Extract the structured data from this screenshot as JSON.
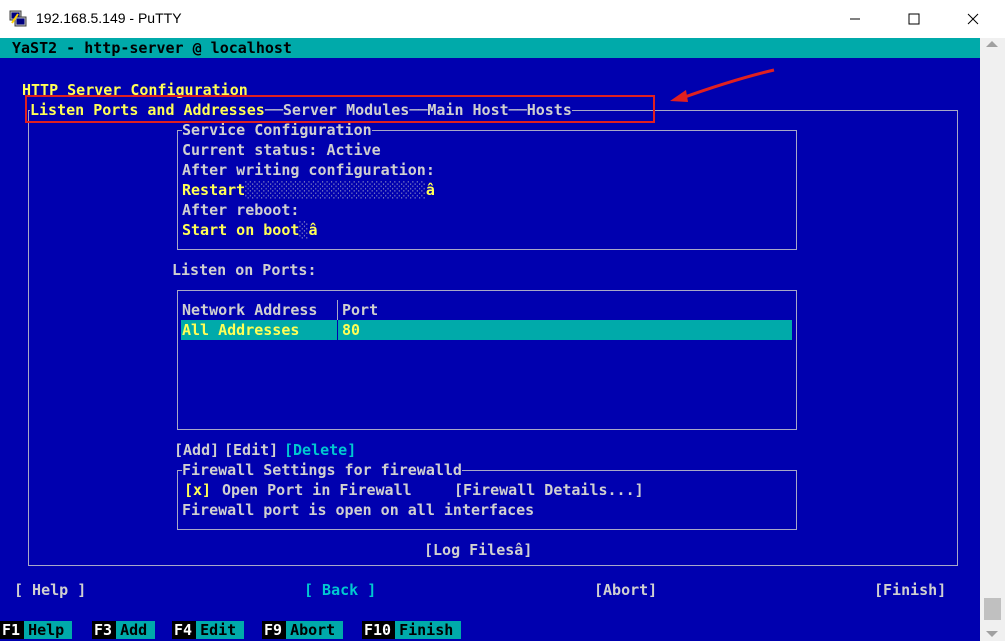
{
  "window": {
    "title": "192.168.5.149 - PuTTY"
  },
  "yast": {
    "header": "YaST2 - http-server @ localhost",
    "page_title": "HTTP Server Configuration",
    "tabs": [
      {
        "label": "Listen Ports and Addresses"
      },
      {
        "label": "Server Modules"
      },
      {
        "label": "Main Host"
      },
      {
        "label": "Hosts"
      }
    ],
    "service": {
      "frame_label": "Service Configuration",
      "current_status": "Current status: Active",
      "after_writing": "After writing configuration:",
      "after_writing_value": "Restart",
      "after_reboot": "After reboot:",
      "after_reboot_value": "Start on boot",
      "dropdown_glyph": "â"
    },
    "ports": {
      "label": "Listen on Ports:",
      "columns": [
        "Network Address",
        "Port"
      ],
      "rows": [
        {
          "address": "All Addresses",
          "port": "80"
        }
      ],
      "add_button": "[Add]",
      "edit_button": "[Edit]",
      "delete_button": "[Delete]"
    },
    "firewall": {
      "frame_label": "Firewall Settings for firewalld",
      "checkbox_state": "[x]",
      "checkbox_label": "Open Port in Firewall",
      "details_button": "[Firewall Details...]",
      "status_text": "Firewall port is open on all interfaces"
    },
    "log_files_button": "[Log Filesâ]",
    "bottom_buttons": {
      "help": "[ Help ]",
      "back": "[ Back ]",
      "abort": "[Abort]",
      "finish": "[Finish]"
    },
    "function_keys": [
      {
        "key": "F1",
        "label": "Help"
      },
      {
        "key": "F3",
        "label": "Add"
      },
      {
        "key": "F4",
        "label": "Edit"
      },
      {
        "key": "F9",
        "label": "Abort"
      },
      {
        "key": "F10",
        "label": "Finish"
      }
    ]
  },
  "colors": {
    "terminal_bg": "#0000af",
    "accent_cyan": "#00aaaa",
    "highlight_yellow": "#ffff55",
    "annotation_red": "#e02020"
  }
}
